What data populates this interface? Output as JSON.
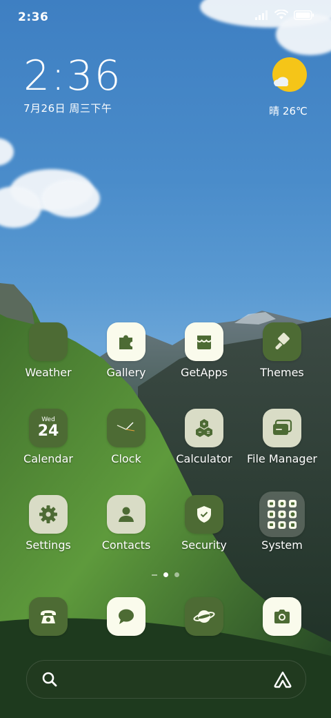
{
  "status_bar": {
    "time": "2:36",
    "signal_icon": "signal-icon",
    "wifi_icon": "wifi-icon",
    "battery_icon": "battery-icon"
  },
  "clock_widget": {
    "time": "2:36",
    "date": "7月26日 周三下午"
  },
  "weather_widget": {
    "icon": "sun-cloud-icon",
    "text": "晴 26℃"
  },
  "apps": [
    {
      "label": "Weather"
    },
    {
      "label": "Gallery"
    },
    {
      "label": "GetApps"
    },
    {
      "label": "Themes"
    },
    {
      "label": "Calendar",
      "weekday": "Wed",
      "day": "24"
    },
    {
      "label": "Clock"
    },
    {
      "label": "Calculator"
    },
    {
      "label": "File Manager"
    },
    {
      "label": "Settings"
    },
    {
      "label": "Contacts"
    },
    {
      "label": "Security"
    },
    {
      "label": "System"
    }
  ],
  "page_indicator": {
    "pages": 2,
    "current": 1
  },
  "dock": [
    "phone-icon",
    "messages-icon",
    "browser-icon",
    "camera-icon"
  ],
  "search_bar": {
    "search_icon": "search-icon",
    "assistant_icon": "assistant-icon"
  },
  "colors": {
    "icon_dark": "#4d6b34",
    "icon_cream": "#fafbec",
    "icon_sage": "#d9dcc6"
  }
}
